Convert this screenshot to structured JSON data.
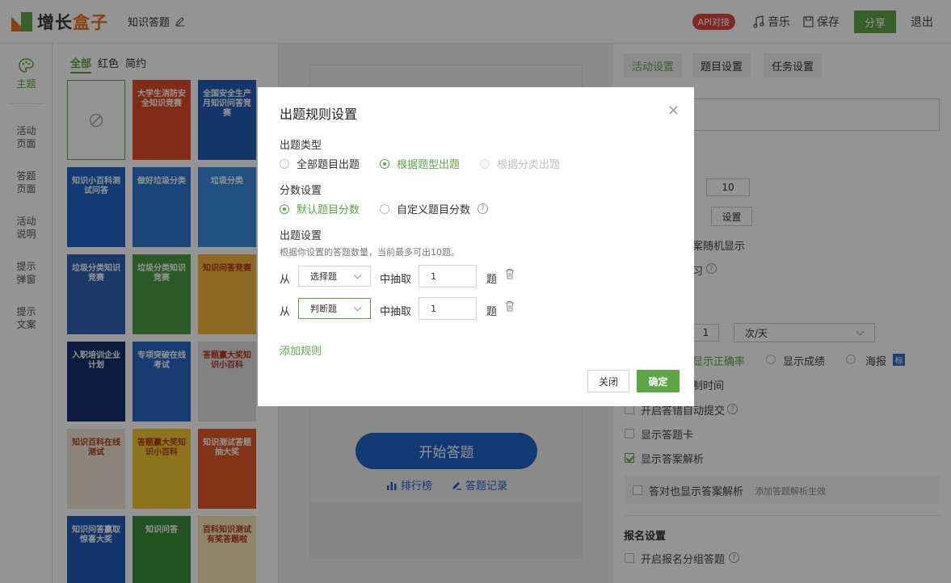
{
  "header": {
    "logo_part1": "增长",
    "logo_part2": "盒子",
    "doc_title": "知识答题",
    "api_badge": "API对接",
    "music_label": "音乐",
    "save_label": "保存",
    "share_label": "分享",
    "logout_label": "退出"
  },
  "leftnav": {
    "items": [
      {
        "label": "主题"
      },
      {
        "label": "活动页面"
      },
      {
        "label": "答题页面"
      },
      {
        "label": "活动说明"
      },
      {
        "label": "提示弹窗"
      },
      {
        "label": "提示文案"
      }
    ]
  },
  "templates": {
    "tabs": [
      "全部",
      "红色",
      "简约"
    ],
    "items": [
      {
        "title": "",
        "bg": "#ffffff"
      },
      {
        "title": "大学生消防安全知识竞赛",
        "bg": "#e04a26"
      },
      {
        "title": "全国安全生产月知识问答竞赛",
        "bg": "#1f5fb4"
      },
      {
        "title": "知识小百科测试问答",
        "bg": "#1f66c9"
      },
      {
        "title": "做好垃圾分类",
        "bg": "#2d78d4"
      },
      {
        "title": "垃圾分类",
        "bg": "#3c8ee0"
      },
      {
        "title": "垃圾分类知识竞赛",
        "bg": "#2e62b5"
      },
      {
        "title": "垃圾分类知识竞赛",
        "bg": "#4d9c44"
      },
      {
        "title": "知识问答竞赛",
        "bg": "#f3b63a"
      },
      {
        "title": "入职培训企业计划",
        "bg": "#14306b"
      },
      {
        "title": "专项突破在线考试",
        "bg": "#2a68c4"
      },
      {
        "title": "答题赢大奖知识小百科",
        "bg": "#dedede"
      },
      {
        "title": "知识百科在线测试",
        "bg": "#f1e6d4"
      },
      {
        "title": "答题赢大奖知识小百科",
        "bg": "#f2c634"
      },
      {
        "title": "知识测试答题抽大奖",
        "bg": "#e35a26"
      },
      {
        "title": "知识问答赢取惊喜大奖",
        "bg": "#1f5cb8"
      },
      {
        "title": "知识问答",
        "bg": "#3c8c3c"
      },
      {
        "title": "百科知识测试有奖答题啦",
        "bg": "#f6e6b8"
      }
    ]
  },
  "preview": {
    "start_label": "开始答题",
    "rank_label": "排行榜",
    "record_label": "答题记录"
  },
  "rightpanel": {
    "tabs": [
      "活动设置",
      "题目设置",
      "任务设置"
    ],
    "count_value": "10",
    "setting_label": "设置",
    "random_text": "案随机显示",
    "practice_text": "习",
    "freq_value": "1",
    "freq_unit": "次/天",
    "show_accuracy": "显示正确率",
    "show_score": "显示成绩",
    "poster": "海报",
    "tag": "标",
    "time_limit": "制时间",
    "auto_submit": "开启答错自动提交",
    "show_card": "显示答题卡",
    "show_analysis": "显示答案解析",
    "correct_analysis": "答对也显示答案解析",
    "analysis_hint": "添加答题解析生效",
    "signup_title": "报名设置",
    "group_answer": "开启报名分组答题"
  },
  "modal": {
    "title": "出题规则设置",
    "type_label": "出题类型",
    "type_options": [
      "全部题目出题",
      "根据题型出题",
      "根据分类出题"
    ],
    "score_label": "分数设置",
    "score_options": [
      "默认题目分数",
      "自定义题目分数"
    ],
    "rule_label": "出题设置",
    "rule_hint": "根据你设置的答题数量，当前最多可出10题。",
    "from_label": "从",
    "mid_label": "中抽取",
    "unit_label": "题",
    "rules": [
      {
        "type": "选择题",
        "count": "1"
      },
      {
        "type": "判断题",
        "count": "1"
      }
    ],
    "add_rule": "添加规则",
    "close_label": "关闭",
    "ok_label": "确定"
  },
  "colors": {
    "accent": "#5fa547",
    "start_button": "#1e63c6",
    "api_badge": "#d9473d",
    "logo_accent": "#e9721c"
  }
}
